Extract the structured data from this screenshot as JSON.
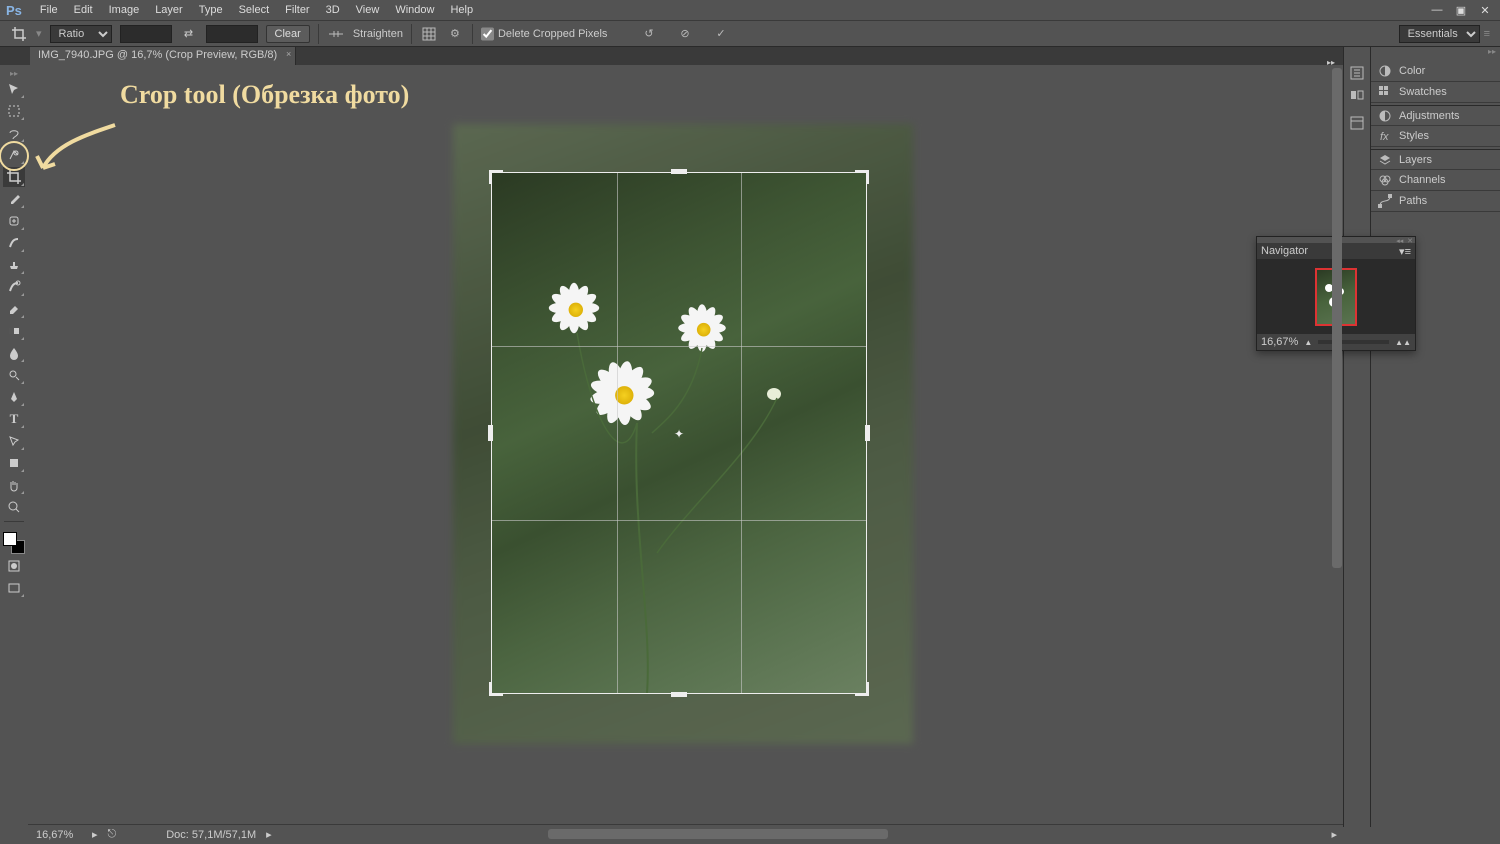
{
  "menu": {
    "app": "Ps",
    "items": [
      "File",
      "Edit",
      "Image",
      "Layer",
      "Type",
      "Select",
      "Filter",
      "3D",
      "View",
      "Window",
      "Help"
    ]
  },
  "options": {
    "ratio_label": "Ratio",
    "clear": "Clear",
    "straighten": "Straighten",
    "delete_cropped": "Delete Cropped Pixels",
    "workspace": "Essentials"
  },
  "tab": {
    "title": "IMG_7940.JPG @ 16,7% (Crop Preview, RGB/8)"
  },
  "annotation": {
    "text": "Crop tool (Обрезка фото)"
  },
  "panels": {
    "color": "Color",
    "swatches": "Swatches",
    "adjustments": "Adjustments",
    "styles": "Styles",
    "layers": "Layers",
    "channels": "Channels",
    "paths": "Paths"
  },
  "navigator": {
    "title": "Navigator",
    "zoom": "16,67%"
  },
  "status": {
    "zoom": "16,67%",
    "doc": "Doc: 57,1M/57,1M"
  }
}
